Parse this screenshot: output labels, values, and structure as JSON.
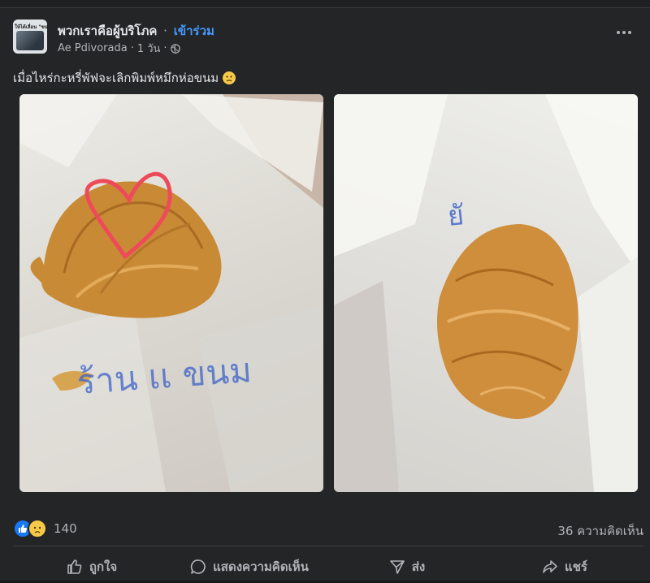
{
  "post": {
    "group_name": "พวกเราคือผู้บริโภค",
    "separator": "·",
    "join_label": "เข้าร่วม",
    "author": "Ae Pdivorada",
    "time": "1 วัน",
    "privacy_icon": "globe-icon",
    "more_icon": "more-options-icon",
    "avatar_text": "ให้ได้เลื่อน \"ขนม\"",
    "caption": "เมื่อไหร่กะหรี่พัฟจะเลิกพิมพ์หมึกห่อขนม"
  },
  "photos": [
    {
      "subject": "curry puff with red heart mark on printed paper"
    },
    {
      "subject": "curry puff on printed paper"
    }
  ],
  "stats": {
    "reaction_icons": [
      "like-icon",
      "sad-icon"
    ],
    "reaction_count": "140",
    "comments": "36 ความคิดเห็น"
  },
  "actions": {
    "like": "ถูกใจ",
    "comment": "แสดงความคิดเห็น",
    "send": "ส่ง",
    "share": "แชร์"
  },
  "colors": {
    "background": "#242526",
    "join_link": "#4599ff",
    "like_blue": "#1877f2",
    "heart_mark": "#ee4a5a"
  }
}
